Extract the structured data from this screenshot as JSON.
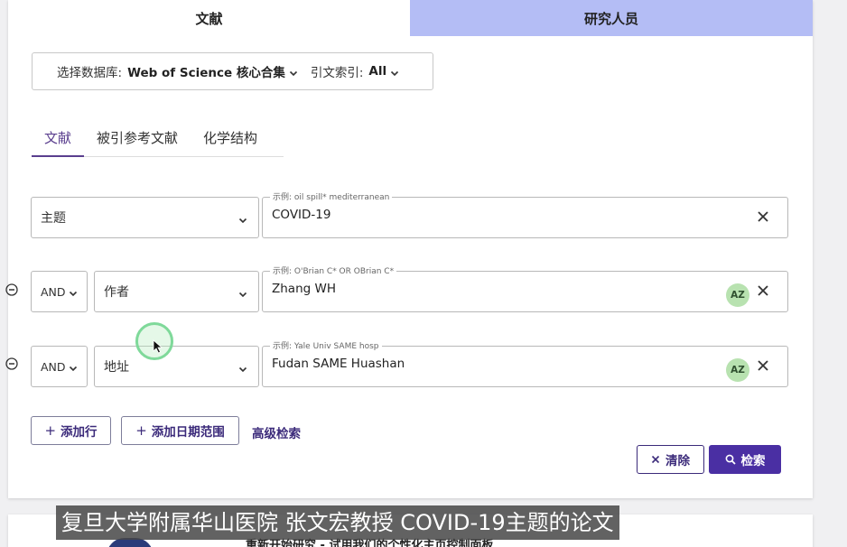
{
  "top_tabs": {
    "documents": "文献",
    "researchers": "研究人员"
  },
  "database": {
    "label": "选择数据库:",
    "value": "Web of Science 核心合集",
    "citation_label": "引文索引:",
    "citation_value": "All"
  },
  "sub_tabs": [
    "文献",
    "被引参考文献",
    "化学结构"
  ],
  "rows": [
    {
      "operator": "",
      "field": "主题",
      "hint": "示例: oil spill* mediterranean",
      "value": "COVID-19"
    },
    {
      "operator": "AND",
      "field": "作者",
      "hint": "示例: O'Brian C* OR OBrian C*",
      "value": "Zhang WH"
    },
    {
      "operator": "AND",
      "field": "地址",
      "hint": "示例: Yale Univ SAME hosp",
      "value": "Fudan SAME Huashan"
    }
  ],
  "actions": {
    "add_row": "添加行",
    "add_date_range": "添加日期范围",
    "advanced_search": "高级检索",
    "clear": "清除",
    "search": "检索"
  },
  "az_badge": "AZ",
  "bottom_text": "重新开始研究 - 试用我们的个性化主页控制面板",
  "subtitle": "复旦大学附属华山医院 张文宏教授 COVID-19主题的论文",
  "colors": {
    "accent": "#4a2fa3",
    "tab_inactive": "#b4bdf5",
    "az_badge": "#b8e2b0"
  }
}
